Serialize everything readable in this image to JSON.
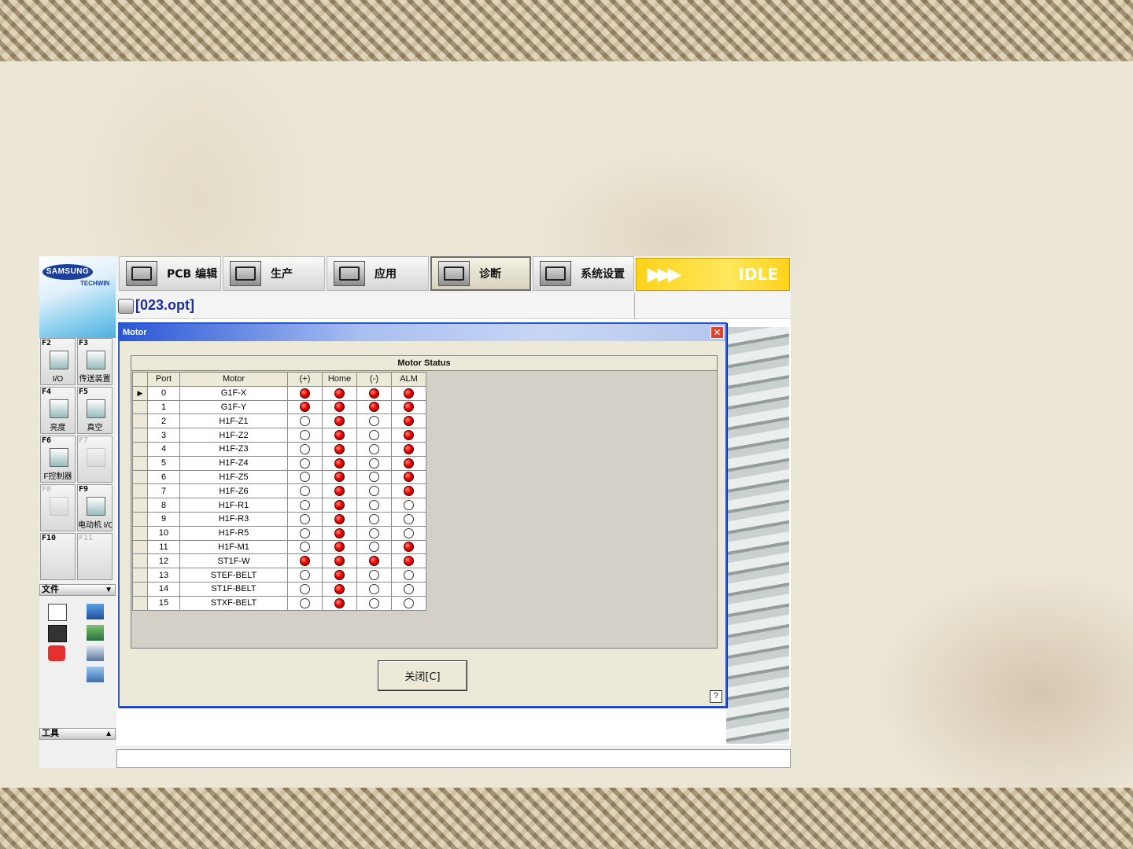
{
  "logo": {
    "brand": "SAMSUNG",
    "sub": "TECHWIN"
  },
  "tabs": [
    {
      "label": "PCB 编辑",
      "icon": "pcb-edit-icon"
    },
    {
      "label": "生产",
      "icon": "production-icon"
    },
    {
      "label": "应用",
      "icon": "application-icon"
    },
    {
      "label": "诊断",
      "icon": "diagnostics-icon",
      "active": true
    },
    {
      "label": "系统设置",
      "icon": "system-settings-icon"
    }
  ],
  "status": {
    "arrows": "▶▶▶",
    "label": "IDLE"
  },
  "file": {
    "name": "[023.opt]"
  },
  "sidebar": {
    "fkeys": [
      {
        "key": "F2",
        "label": "I/O"
      },
      {
        "key": "F3",
        "label": "传送装置"
      },
      {
        "key": "F4",
        "label": "亮度"
      },
      {
        "key": "F5",
        "label": "真空"
      },
      {
        "key": "F6",
        "label": "F控制器"
      },
      {
        "key": "F7",
        "label": ""
      },
      {
        "key": "F8",
        "label": ""
      },
      {
        "key": "F9",
        "label": "电动机 I/O"
      },
      {
        "key": "F10",
        "label": ""
      },
      {
        "key": "F11",
        "label": ""
      }
    ],
    "file_section": "文件",
    "tools_section": "工具"
  },
  "dialog": {
    "title": "Motor",
    "panel_title": "Motor Status",
    "columns": [
      "Port",
      "Motor",
      "(+)",
      "Home",
      "(-)",
      "ALM"
    ],
    "rows": [
      {
        "port": "0",
        "motor": "G1F-X",
        "plus": 1,
        "home": 1,
        "minus": 1,
        "alm": 1
      },
      {
        "port": "1",
        "motor": "G1F-Y",
        "plus": 1,
        "home": 1,
        "minus": 1,
        "alm": 1
      },
      {
        "port": "2",
        "motor": "H1F-Z1",
        "plus": 0,
        "home": 1,
        "minus": 0,
        "alm": 1
      },
      {
        "port": "3",
        "motor": "H1F-Z2",
        "plus": 0,
        "home": 1,
        "minus": 0,
        "alm": 1
      },
      {
        "port": "4",
        "motor": "H1F-Z3",
        "plus": 0,
        "home": 1,
        "minus": 0,
        "alm": 1
      },
      {
        "port": "5",
        "motor": "H1F-Z4",
        "plus": 0,
        "home": 1,
        "minus": 0,
        "alm": 1
      },
      {
        "port": "6",
        "motor": "H1F-Z5",
        "plus": 0,
        "home": 1,
        "minus": 0,
        "alm": 1
      },
      {
        "port": "7",
        "motor": "H1F-Z6",
        "plus": 0,
        "home": 1,
        "minus": 0,
        "alm": 1
      },
      {
        "port": "8",
        "motor": "H1F-R1",
        "plus": 0,
        "home": 1,
        "minus": 0,
        "alm": 0
      },
      {
        "port": "9",
        "motor": "H1F-R3",
        "plus": 0,
        "home": 1,
        "minus": 0,
        "alm": 0
      },
      {
        "port": "10",
        "motor": "H1F-R5",
        "plus": 0,
        "home": 1,
        "minus": 0,
        "alm": 0
      },
      {
        "port": "11",
        "motor": "H1F-M1",
        "plus": 0,
        "home": 1,
        "minus": 0,
        "alm": 1
      },
      {
        "port": "12",
        "motor": "ST1F-W",
        "plus": 1,
        "home": 1,
        "minus": 1,
        "alm": 1
      },
      {
        "port": "13",
        "motor": "STEF-BELT",
        "plus": 0,
        "home": 1,
        "minus": 0,
        "alm": 0
      },
      {
        "port": "14",
        "motor": "ST1F-BELT",
        "plus": 0,
        "home": 1,
        "minus": 0,
        "alm": 0
      },
      {
        "port": "15",
        "motor": "STXF-BELT",
        "plus": 0,
        "home": 1,
        "minus": 0,
        "alm": 0
      }
    ],
    "selected_row": 0,
    "close_button": "关闭[C]",
    "help": "?"
  },
  "colors": {
    "led_on": "#e00000",
    "title_bar": "#2a56d6",
    "idle_bg": "#ffd21a"
  }
}
